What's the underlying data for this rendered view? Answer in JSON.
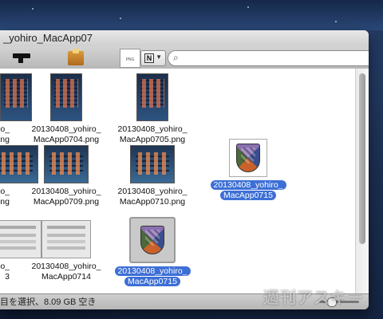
{
  "window": {
    "title": "_yohiro_MacApp07"
  },
  "toolbar": {
    "doc_icon_text": "PNG",
    "sort_letter": "N",
    "search": {
      "value": "",
      "placeholder": ""
    }
  },
  "files": [
    {
      "line1": "o_",
      "line2": "png"
    },
    {
      "line1": "20130408_yohiro_",
      "line2": "MacApp0704.png"
    },
    {
      "line1": "20130408_yohiro_",
      "line2": "MacApp0705.png"
    },
    {
      "line1": "o_",
      "line2": "png"
    },
    {
      "line1": "20130408_yohiro_",
      "line2": "MacApp0709.png"
    },
    {
      "line1": "20130408_yohiro_",
      "line2": "MacApp0710.png"
    },
    {
      "line1": "20130408_yohiro_",
      "line2": "MacApp0715"
    },
    {
      "line1": "o_",
      "line2": "3"
    },
    {
      "line1": "20130408_yohiro_",
      "line2": "MacApp0714"
    },
    {
      "line1": "20130408_yohiro_",
      "line2": "MacApp0715"
    }
  ],
  "status": {
    "text": "目を選択、8.09 GB 空き"
  },
  "watermark": "週刊アスキー",
  "colors": {
    "selection": "#3d6fd6",
    "toolbar": "#c4c4c4"
  }
}
